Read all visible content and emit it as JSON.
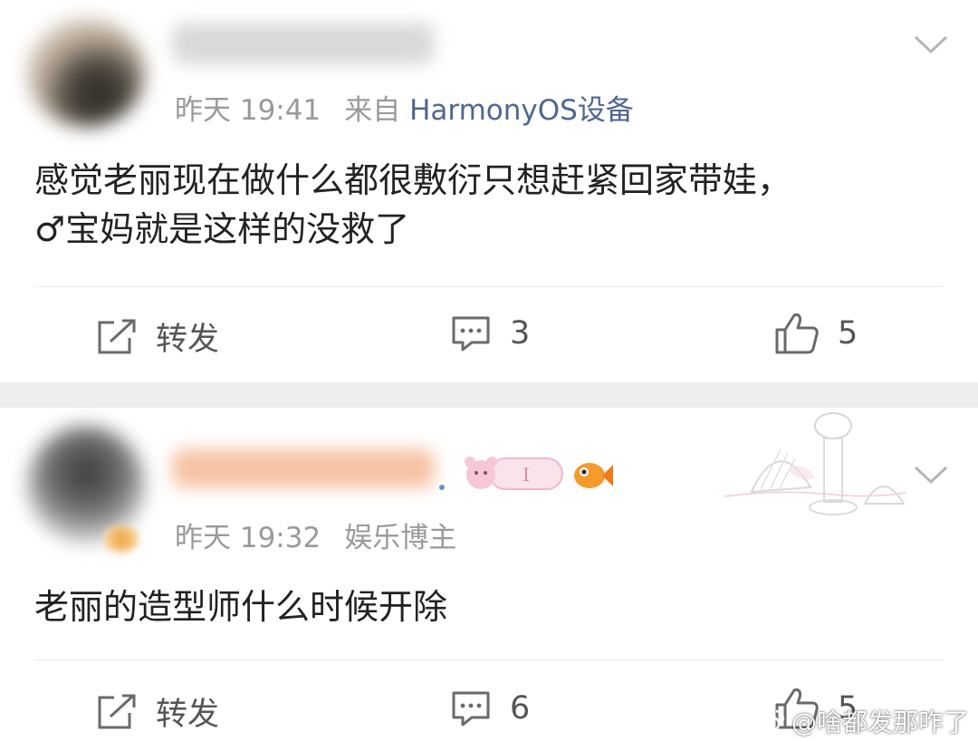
{
  "comments": [
    {
      "time": "昨天 19:41",
      "source": "来自",
      "device": "HarmonyOS设备",
      "content_line1": "感觉老丽现在做什么都很敷衍只想赶紧回家带娃，",
      "content_line2": "♂宝妈就是这样的没救了",
      "repost_label": "转发",
      "comment_count": "3",
      "like_count": "5"
    },
    {
      "time": "昨天 19:32",
      "source": "娱乐博主",
      "content_line1": "老丽的造型师什么时候开除",
      "repost_label": "转发",
      "comment_count": "6",
      "like_count": "5"
    }
  ],
  "watermark": {
    "text": "@啥都发那咋了"
  },
  "icons": [
    "chevron-down-icon",
    "repost-icon",
    "comment-icon",
    "like-icon",
    "weibo-logo-icon"
  ]
}
